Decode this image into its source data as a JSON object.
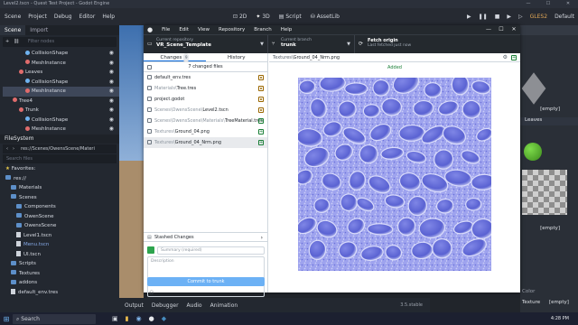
{
  "godot": {
    "window_title": "Level2.tscn - Quest Test Project - Godot Engine",
    "menu": [
      "Scene",
      "Project",
      "Debug",
      "Editor",
      "Help"
    ],
    "modes": [
      "2D",
      "3D",
      "Script",
      "AssetLib"
    ],
    "renderer": "GLES2",
    "layout": "Default",
    "scene_tabs": [
      "Scene",
      "Import"
    ],
    "filter_placeholder": "Filter nodes",
    "scene_tree": [
      {
        "label": "CollisionShape",
        "color": "#6fb3f0",
        "indent": 3
      },
      {
        "label": "MeshInstance",
        "color": "#e06c6c",
        "indent": 3
      },
      {
        "label": "Leaves",
        "color": "#e06c6c",
        "indent": 2
      },
      {
        "label": "CollisionShape",
        "color": "#6fb3f0",
        "indent": 3
      },
      {
        "label": "MeshInstance",
        "color": "#e06c6c",
        "indent": 3,
        "selected": true
      },
      {
        "label": "Tree4",
        "color": "#e06c6c",
        "indent": 1
      },
      {
        "label": "Trunk",
        "color": "#e06c6c",
        "indent": 2
      },
      {
        "label": "CollisionShape",
        "color": "#6fb3f0",
        "indent": 3
      },
      {
        "label": "MeshInstance",
        "color": "#e06c6c",
        "indent": 3
      }
    ],
    "filesystem": {
      "title": "FileSystem",
      "path": "res://Scenes/OwensScene/Materi",
      "search_placeholder": "Search files",
      "items": [
        {
          "label": "Favorites:",
          "type": "star",
          "indent": 0
        },
        {
          "label": "res://",
          "type": "folder",
          "indent": 0
        },
        {
          "label": "Materials",
          "type": "folder",
          "indent": 1
        },
        {
          "label": "Scenes",
          "type": "folder",
          "indent": 1
        },
        {
          "label": "Components",
          "type": "folder",
          "indent": 2
        },
        {
          "label": "OwenScene",
          "type": "folder",
          "indent": 2
        },
        {
          "label": "OwensScene",
          "type": "folder",
          "indent": 2
        },
        {
          "label": "Level1.tscn",
          "type": "file",
          "indent": 2
        },
        {
          "label": "Menu.tscn",
          "type": "file",
          "indent": 2,
          "highlight": true
        },
        {
          "label": "UI.tscn",
          "type": "file",
          "indent": 2
        },
        {
          "label": "Scripts",
          "type": "folder",
          "indent": 1
        },
        {
          "label": "Textures",
          "type": "folder",
          "indent": 1
        },
        {
          "label": "addons",
          "type": "folder",
          "indent": 1
        },
        {
          "label": "default_env.tres",
          "type": "file",
          "indent": 1
        }
      ]
    },
    "bottom_tabs": [
      "Output",
      "Debugger",
      "Audio",
      "Animation"
    ],
    "version": "3.5.stable",
    "inspector": {
      "empty1": "[empty]",
      "leaves": "Leaves",
      "empty2": "[empty]",
      "color_label": "Color",
      "texture_label": "Texture",
      "empty3": "[empty]"
    }
  },
  "github": {
    "menu": [
      "File",
      "Edit",
      "View",
      "Repository",
      "Branch",
      "Help"
    ],
    "toolbar": {
      "repo_label": "Current repository",
      "repo_value": "VR_Scene_Template",
      "branch_label": "Current branch",
      "branch_value": "trunk",
      "fetch_label": "Fetch origin",
      "fetch_sub": "Last fetched just now"
    },
    "tabs": {
      "changes": "Changes",
      "changes_count": "9",
      "history": "History"
    },
    "changed_summary": "7 changed files",
    "files": [
      {
        "prefix": "",
        "name": "default_env.tres",
        "status": "modified"
      },
      {
        "prefix": "Materials\\",
        "name": "Tree.tres",
        "status": "modified"
      },
      {
        "prefix": "",
        "name": "project.godot",
        "status": "modified"
      },
      {
        "prefix": "Scenes\\OwensScene\\",
        "name": "Level2.tscn",
        "status": "modified"
      },
      {
        "prefix": "Scenes\\OwensScene\\Materials\\",
        "name": "TreeMaterial.tres",
        "status": "added"
      },
      {
        "prefix": "Textures\\",
        "name": "Ground_04.png",
        "status": "added"
      },
      {
        "prefix": "Textures\\",
        "name": "Ground_04_Nrm.png",
        "status": "added",
        "selected": true
      }
    ],
    "stash_label": "Stashed Changes",
    "summary_placeholder": "Summary (required)",
    "description_placeholder": "Description",
    "commit_button": "Commit to trunk",
    "diff": {
      "path_prefix": "Textures\\",
      "path_file": "Ground_04_Nrm.png",
      "status": "Added"
    }
  },
  "taskbar": {
    "search": "Search",
    "time": "4:28 PM"
  }
}
